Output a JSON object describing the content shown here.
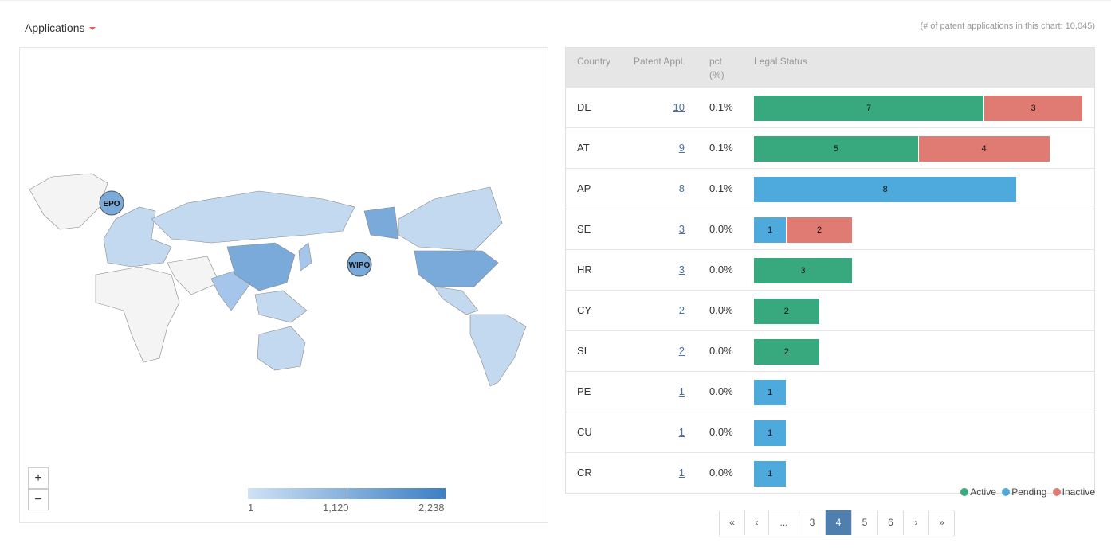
{
  "header": {
    "dropdown_label": "Applications",
    "count_note": "(# of patent applications in this chart: 10,045)"
  },
  "map": {
    "markers": [
      "EPO",
      "WIPO"
    ],
    "zoom_in": "+",
    "zoom_out": "−",
    "legend": {
      "min": "1",
      "mid": "1,120",
      "max": "2,238",
      "color_low": "#cfe1f5",
      "color_high": "#3d7fc2"
    }
  },
  "table": {
    "headers": {
      "country": "Country",
      "appl": "Patent Appl.",
      "pct1": "pct",
      "pct2": "(%)",
      "status": "Legal Status"
    },
    "rows": [
      {
        "country": "DE",
        "appl": "10",
        "pct": "0.1%",
        "active": 7,
        "pending": 0,
        "inactive": 3
      },
      {
        "country": "AT",
        "appl": "9",
        "pct": "0.1%",
        "active": 5,
        "pending": 0,
        "inactive": 4
      },
      {
        "country": "AP",
        "appl": "8",
        "pct": "0.1%",
        "active": 0,
        "pending": 8,
        "inactive": 0
      },
      {
        "country": "SE",
        "appl": "3",
        "pct": "0.0%",
        "active": 0,
        "pending": 1,
        "inactive": 2
      },
      {
        "country": "HR",
        "appl": "3",
        "pct": "0.0%",
        "active": 3,
        "pending": 0,
        "inactive": 0
      },
      {
        "country": "CY",
        "appl": "2",
        "pct": "0.0%",
        "active": 2,
        "pending": 0,
        "inactive": 0
      },
      {
        "country": "SI",
        "appl": "2",
        "pct": "0.0%",
        "active": 2,
        "pending": 0,
        "inactive": 0
      },
      {
        "country": "PE",
        "appl": "1",
        "pct": "0.0%",
        "active": 0,
        "pending": 1,
        "inactive": 0
      },
      {
        "country": "CU",
        "appl": "1",
        "pct": "0.0%",
        "active": 0,
        "pending": 1,
        "inactive": 0
      },
      {
        "country": "CR",
        "appl": "1",
        "pct": "0.0%",
        "active": 0,
        "pending": 1,
        "inactive": 0
      }
    ]
  },
  "status_legend": [
    {
      "label": "Active",
      "color": "#38a97f"
    },
    {
      "label": "Pending",
      "color": "#4eaadd"
    },
    {
      "label": "Inactive",
      "color": "#e07b73"
    }
  ],
  "pagination": {
    "items": [
      "«",
      "‹",
      "...",
      "3",
      "4",
      "5",
      "6",
      "›",
      "»"
    ],
    "current": "4"
  }
}
